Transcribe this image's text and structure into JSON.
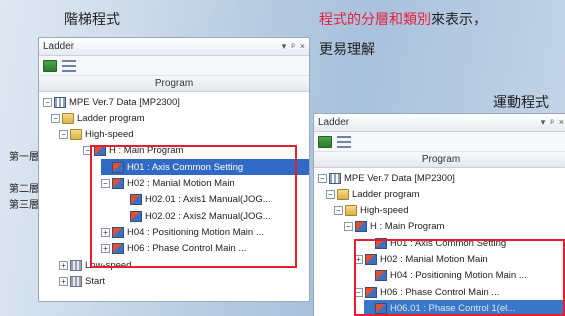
{
  "captions": {
    "ladder_program": "階梯程式",
    "desc_highlight": "程式的分層和類別",
    "desc_rest": "來表示，",
    "desc_line2": "更易理解",
    "motion_program": "運動程式"
  },
  "levels": [
    "第一層",
    "第二層",
    "第三層"
  ],
  "left_panel": {
    "title": "Ladder",
    "title_buttons": [
      "▾",
      "ᵖ",
      "×"
    ],
    "column_header": "Program",
    "tree": [
      {
        "text": "MPE Ver.7 Data [MP2300]",
        "icon": "project-icon",
        "expander": "⊟"
      },
      {
        "text": "Ladder program",
        "icon": "folder-icon",
        "expander": "⊟"
      },
      {
        "text": "High-speed",
        "icon": "folder-icon",
        "expander": "⊟"
      },
      {
        "text": "H : Main Program",
        "icon": "program-icon",
        "expander": "⊟"
      },
      {
        "text": "H01 : Axis Common Setting",
        "icon": "program-icon",
        "expander": ""
      },
      {
        "text": "H02 : Manial Motion Main",
        "icon": "program-icon",
        "expander": "⊟"
      },
      {
        "text": "H02.01 : Axis1 Manual(JOG...",
        "icon": "program-icon",
        "expander": ""
      },
      {
        "text": "H02.02 : Axis2 Manual(JOG...",
        "icon": "program-icon",
        "expander": ""
      },
      {
        "text": "H04 : Positioning Motion Main ...",
        "icon": "program-icon",
        "expander": "⊞"
      },
      {
        "text": "H06 : Phase Control Main     ...",
        "icon": "program-icon",
        "expander": "⊞"
      },
      {
        "text": "Low-speed",
        "icon": "grid-icon",
        "expander": "⊞"
      },
      {
        "text": "Start",
        "icon": "grid-icon",
        "expander": "⊞"
      }
    ]
  },
  "right_panel": {
    "title": "Ladder",
    "title_buttons": [
      "▾",
      "ᵖ",
      "×"
    ],
    "column_header": "Program",
    "tree": [
      {
        "text": "MPE Ver.7 Data [MP2300]",
        "icon": "project-icon",
        "expander": "⊟"
      },
      {
        "text": "Ladder program",
        "icon": "folder-icon",
        "expander": "⊟"
      },
      {
        "text": "High-speed",
        "icon": "folder-icon",
        "expander": "⊟"
      },
      {
        "text": "H : Main Program",
        "icon": "program-icon",
        "expander": "⊟"
      },
      {
        "text": "H01 : Axis Common Setting",
        "icon": "program-icon",
        "expander": ""
      },
      {
        "text": "H02 : Manial Motion Main",
        "icon": "program-icon",
        "expander": "⊞"
      },
      {
        "text": "H04 : Positioning Motion Main ...",
        "icon": "program-icon",
        "expander": ""
      },
      {
        "text": "H06 : Phase Control Main    ...",
        "icon": "program-icon",
        "expander": "⊟"
      },
      {
        "text": "H06.01 : Phase Control 1(el...",
        "icon": "program-icon",
        "expander": ""
      }
    ]
  }
}
